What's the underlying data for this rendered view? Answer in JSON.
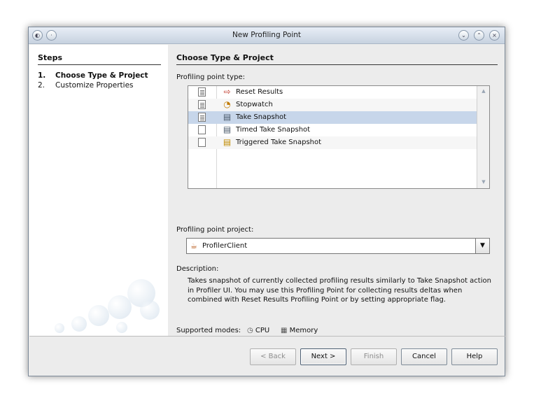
{
  "window": {
    "title": "New Profiling Point"
  },
  "steps": {
    "title": "Steps",
    "items": [
      {
        "num": "1.",
        "label": "Choose Type & Project"
      },
      {
        "num": "2.",
        "label": "Customize Properties"
      }
    ]
  },
  "main": {
    "title": "Choose Type & Project",
    "type_label": "Profiling point type:",
    "types": [
      {
        "label": "Reset Results",
        "icon": "reset-results-icon"
      },
      {
        "label": "Stopwatch",
        "icon": "stopwatch-icon"
      },
      {
        "label": "Take Snapshot",
        "icon": "snapshot-icon"
      },
      {
        "label": "Timed Take Snapshot",
        "icon": "timed-snapshot-icon"
      },
      {
        "label": "Triggered Take Snapshot",
        "icon": "triggered-snapshot-icon"
      }
    ],
    "selected_type": "Take Snapshot",
    "project_label": "Profiling point project:",
    "project_value": "ProfilerClient",
    "description_label": "Description:",
    "description": "Takes snapshot of currently collected profiling results similarly to Take Snapshot action in Profiler UI. You may use this Profiling Point for collecting results deltas when combined with Reset Results Profiling Point or by setting appropriate flag.",
    "supported_modes_label": "Supported modes:",
    "modes": [
      "CPU",
      "Memory"
    ]
  },
  "buttons": {
    "back": "< Back",
    "next": "Next >",
    "finish": "Finish",
    "cancel": "Cancel",
    "help": "Help"
  }
}
